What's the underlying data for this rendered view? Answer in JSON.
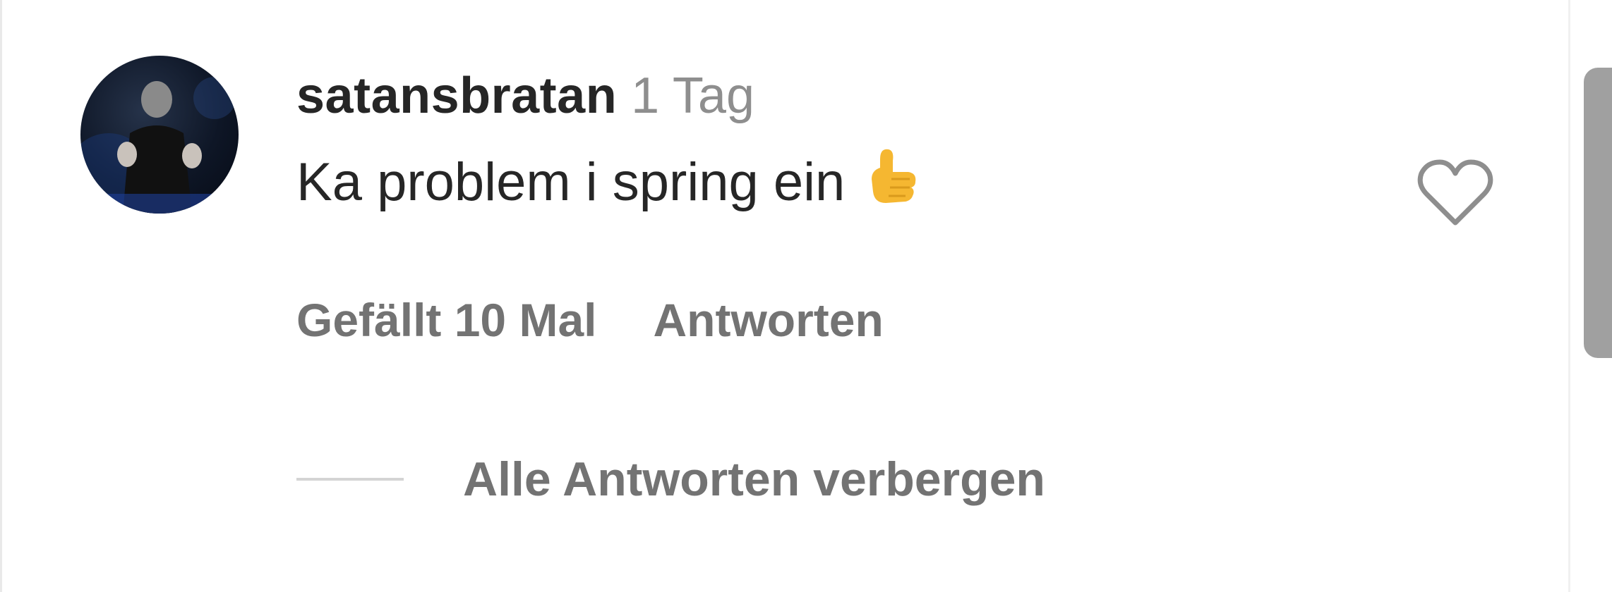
{
  "comment": {
    "username": "satansbratan",
    "time": "1 Tag",
    "text": "Ka problem i spring ein",
    "emoji": "call-me-hand-emoji"
  },
  "actions": {
    "likes": "Gefällt 10 Mal",
    "reply": "Antworten"
  },
  "replies_toggle": {
    "label": "Alle Antworten verbergen"
  },
  "icons": {
    "like": "heart-icon",
    "avatar": "user-avatar"
  },
  "colors": {
    "text_primary": "#262626",
    "text_secondary": "#737373",
    "timestamp": "#8e8e8e",
    "emoji": "#f5b731"
  }
}
